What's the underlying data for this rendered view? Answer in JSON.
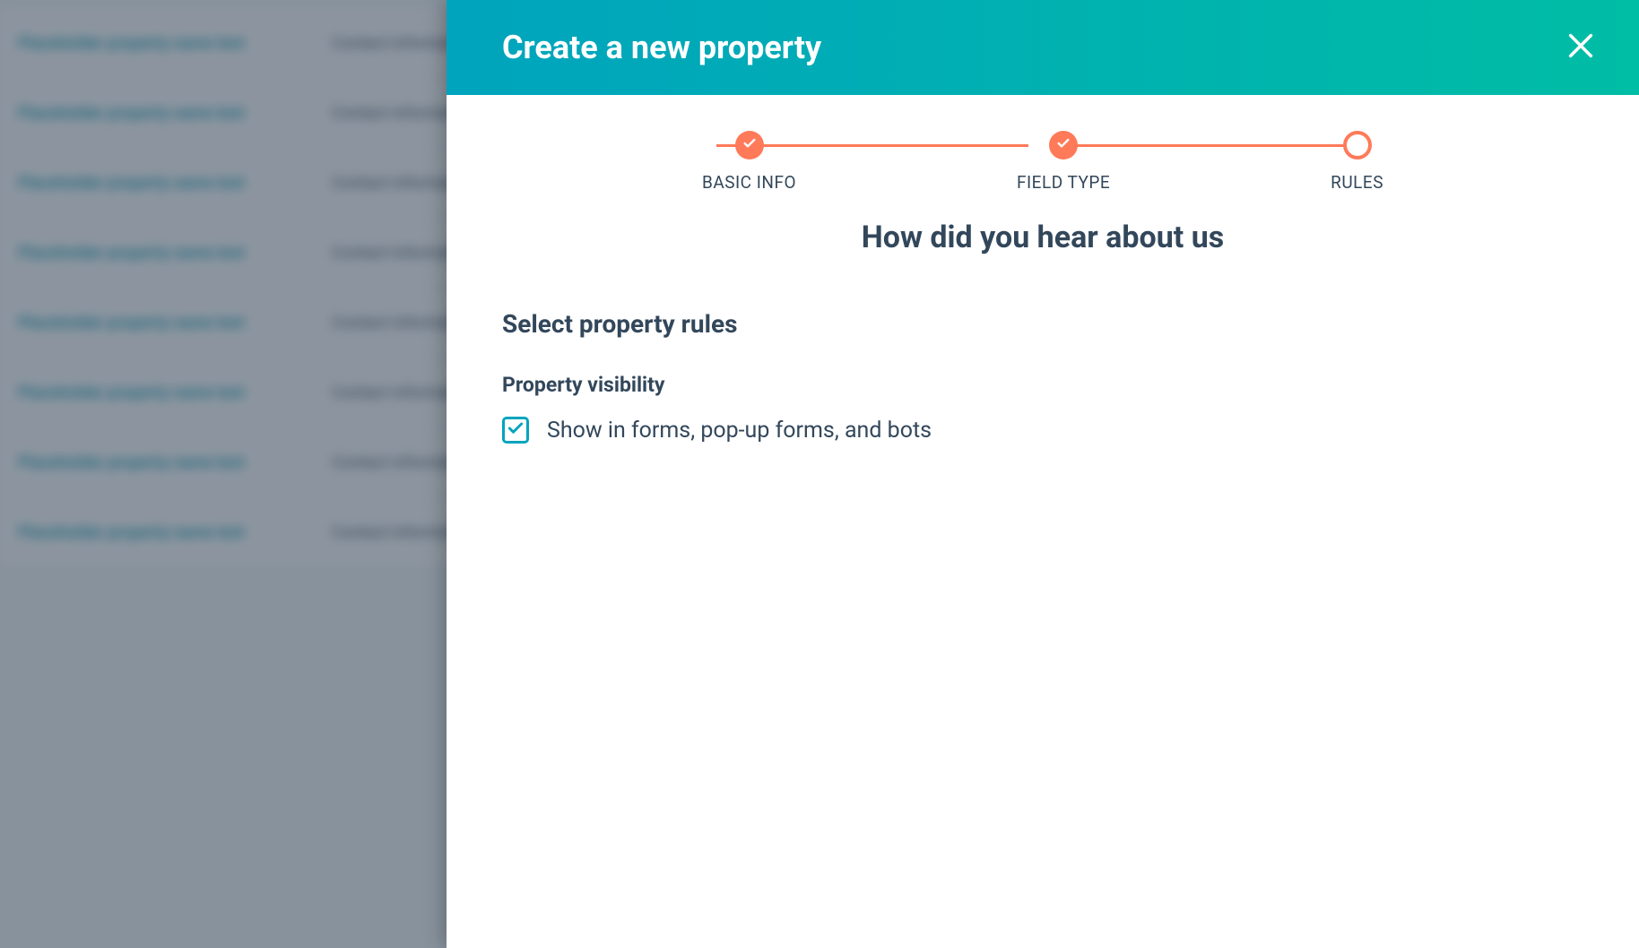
{
  "background": {
    "rows": [
      {
        "name": "Placeholder property name text",
        "group": "Contact information"
      },
      {
        "name": "Placeholder property name text",
        "group": "Contact information"
      },
      {
        "name": "Placeholder property name text",
        "group": "Contact information"
      },
      {
        "name": "Placeholder property name text",
        "group": "Contact information"
      },
      {
        "name": "Placeholder property name text",
        "group": "Contact information"
      },
      {
        "name": "Placeholder property name text",
        "group": "Contact information"
      },
      {
        "name": "Placeholder property name text",
        "group": "Contact information"
      },
      {
        "name": "Placeholder property name text",
        "group": "Contact information"
      }
    ]
  },
  "panel": {
    "title": "Create a new property",
    "steps": {
      "basic_info": "BASIC INFO",
      "field_type": "FIELD TYPE",
      "rules": "RULES"
    },
    "property_name": "How did you hear about us",
    "section_title": "Select property rules",
    "visibility": {
      "title": "Property visibility",
      "checkbox_label": "Show in forms, pop-up forms, and bots",
      "checked": true
    }
  }
}
